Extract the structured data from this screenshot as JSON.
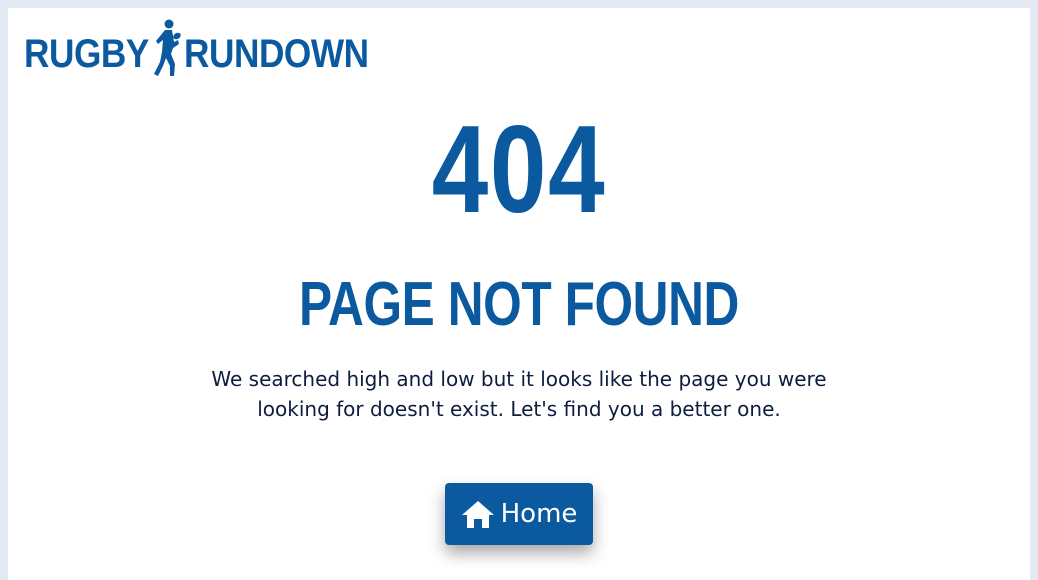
{
  "brand": {
    "name_part1": "RUGBY",
    "name_part2": "RUNDOWN",
    "logo_icon": "rugby-player-icon",
    "color": "#0b5aa0"
  },
  "error": {
    "code": "404",
    "title": "PAGE NOT FOUND",
    "message": "We searched high and low but it looks like the page you were looking for doesn't exist. Let's find you a better one."
  },
  "home_button": {
    "label": "Home",
    "icon": "home-icon"
  },
  "colors": {
    "primary": "#0b5aa0",
    "text": "#0e1d3f",
    "page_bg": "#ffffff",
    "outer_bg": "#e3eaf4"
  }
}
